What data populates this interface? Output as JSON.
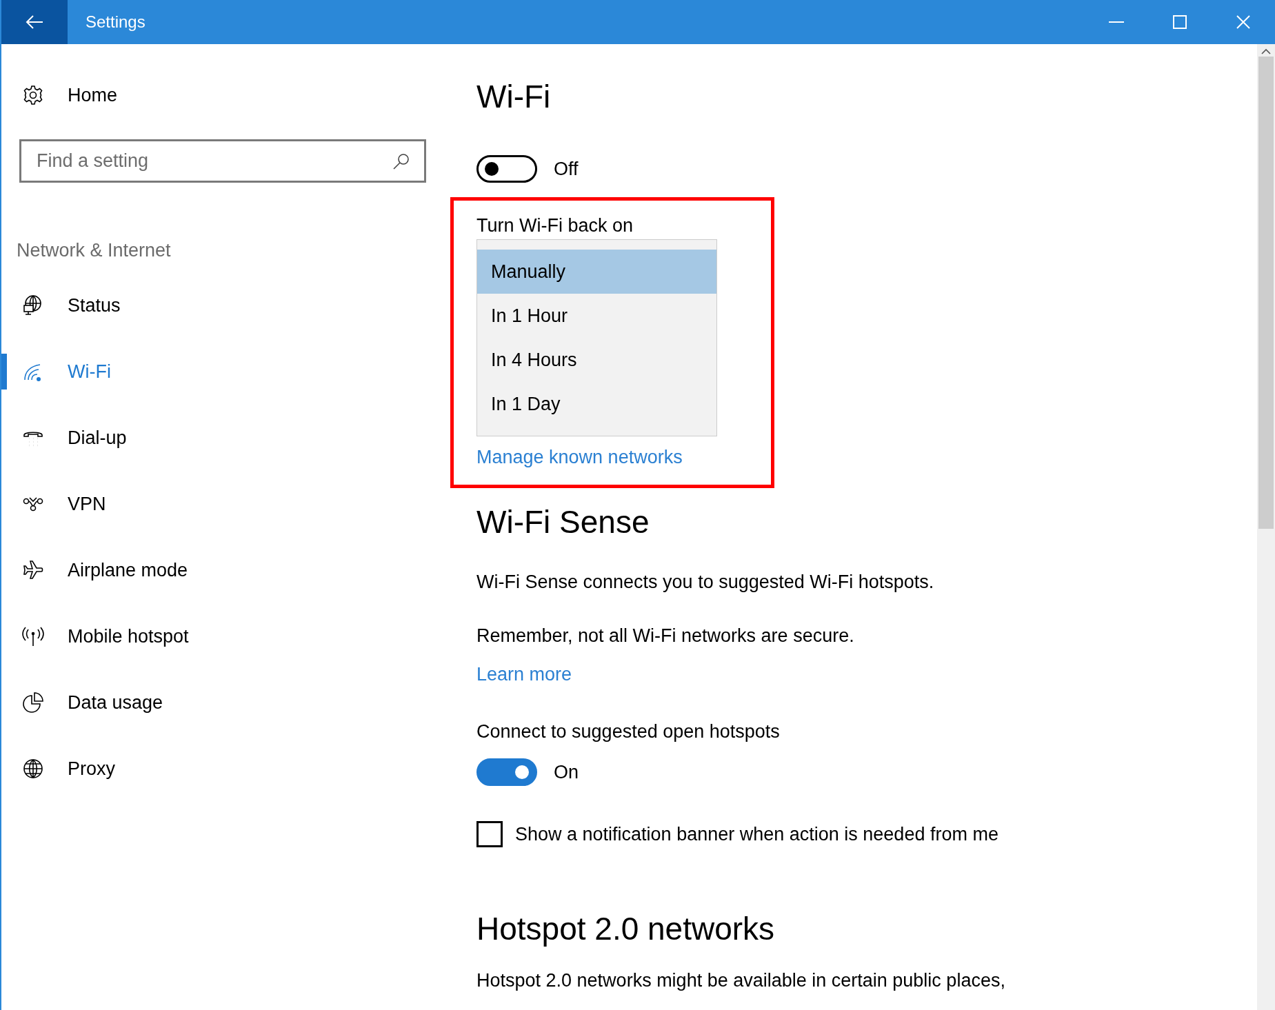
{
  "window": {
    "title": "Settings"
  },
  "sidebar": {
    "home": "Home",
    "search": {
      "placeholder": "Find a setting"
    },
    "section": "Network & Internet",
    "items": [
      {
        "label": "Status",
        "selected": false
      },
      {
        "label": "Wi-Fi",
        "selected": true
      },
      {
        "label": "Dial-up",
        "selected": false
      },
      {
        "label": "VPN",
        "selected": false
      },
      {
        "label": "Airplane mode",
        "selected": false
      },
      {
        "label": "Mobile hotspot",
        "selected": false
      },
      {
        "label": "Data usage",
        "selected": false
      },
      {
        "label": "Proxy",
        "selected": false
      }
    ]
  },
  "wifi": {
    "title": "Wi-Fi",
    "toggle": {
      "on": false,
      "label": "Off"
    }
  },
  "back_on": {
    "highlighted": true,
    "label": "Turn Wi-Fi back on",
    "options": [
      {
        "label": "Manually",
        "selected": true
      },
      {
        "label": "In 1 Hour",
        "selected": false
      },
      {
        "label": "In 4 Hours",
        "selected": false
      },
      {
        "label": "In 1 Day",
        "selected": false
      }
    ],
    "link": "Manage known networks"
  },
  "wifi_sense": {
    "title": "Wi-Fi Sense",
    "paragraphs": [
      "Wi-Fi Sense connects you to suggested Wi-Fi hotspots.",
      "Remember, not all Wi-Fi networks are secure."
    ],
    "link": "Learn more",
    "connect": {
      "label": "Connect to suggested open hotspots",
      "toggle": {
        "on": true,
        "label": "On"
      }
    },
    "notification": {
      "label": "Show a notification banner when action is needed from me",
      "checked": false
    }
  },
  "hotspot": {
    "title": "Hotspot 2.0 networks",
    "text": "Hotspot 2.0 networks might be available in certain public places,"
  }
}
